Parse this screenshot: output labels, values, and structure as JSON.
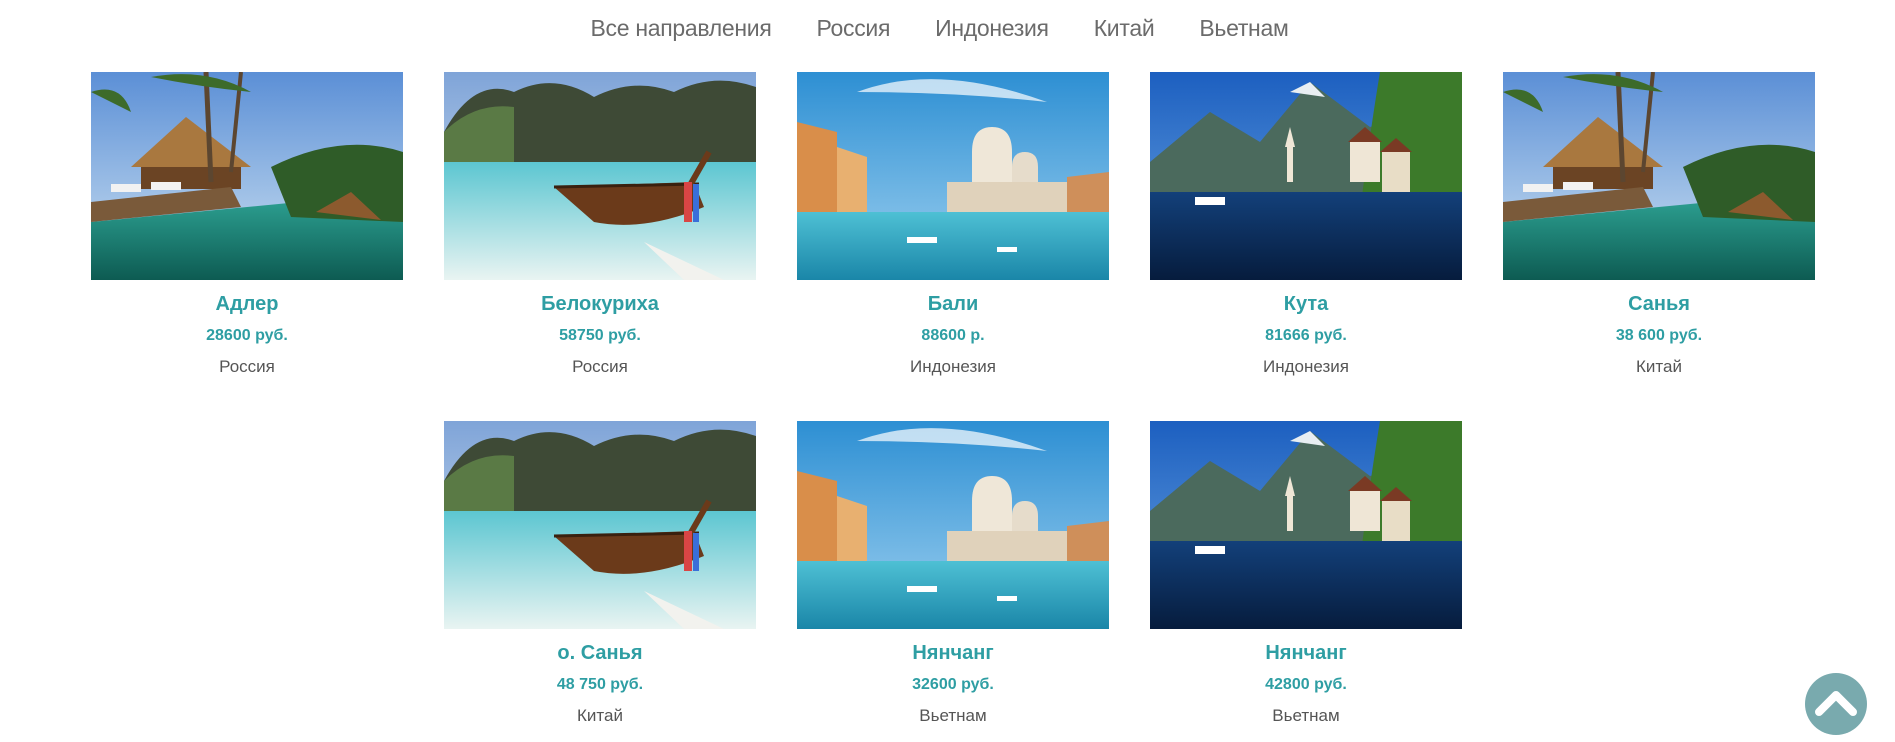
{
  "nav": {
    "items": [
      {
        "label": "Все направления"
      },
      {
        "label": "Россия"
      },
      {
        "label": "Индонезия"
      },
      {
        "label": "Китай"
      },
      {
        "label": "Вьетнам"
      }
    ]
  },
  "tours": [
    {
      "title": "Адлер",
      "price": "28600 руб.",
      "country": "Россия",
      "photo": "resort-pool-photo"
    },
    {
      "title": "Белокуриха",
      "price": "58750 руб.",
      "country": "Россия",
      "photo": "tropical-boat-photo"
    },
    {
      "title": "Бали",
      "price": "88600 р.",
      "country": "Индонезия",
      "photo": "venice-canal-photo"
    },
    {
      "title": "Кута",
      "price": "81666 руб.",
      "country": "Индонезия",
      "photo": "alpine-lake-village-photo"
    },
    {
      "title": "Санья",
      "price": "38 600 руб.",
      "country": "Китай",
      "photo": "resort-pool-photo"
    },
    {
      "title": "о. Санья",
      "price": "48 750 руб.",
      "country": "Китай",
      "photo": "tropical-boat-photo"
    },
    {
      "title": "Нянчанг",
      "price": "32600 руб.",
      "country": "Вьетнам",
      "photo": "venice-canal-photo"
    },
    {
      "title": "Нянчанг",
      "price": "42800 руб.",
      "country": "Вьетнам",
      "photo": "alpine-lake-village-photo"
    }
  ],
  "scroll_top": {
    "icon": "chevron-up-icon"
  },
  "colors": {
    "accent": "#2e9ea3",
    "nav_text": "#6b6b6b",
    "country_text": "#555555",
    "scroll_button": "#79aaae"
  }
}
